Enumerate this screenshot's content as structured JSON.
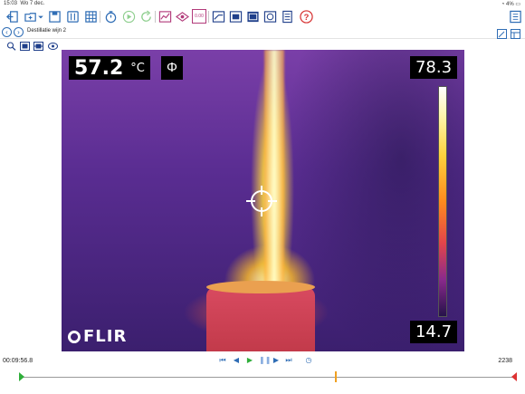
{
  "status": {
    "time": "15:03",
    "date": "Wo 7 dec.",
    "battery": "4%"
  },
  "document": {
    "title": "Destillatie wijn 2"
  },
  "toolbar": {
    "icons": [
      "back-icon",
      "open-folder-icon",
      "save-icon",
      "sensor-settings-icon",
      "table-icon",
      "timer-icon",
      "play-icon",
      "refresh-icon",
      "graph-icon",
      "display-icon",
      "value-icon",
      "gauge-icon",
      "video-icon",
      "camera-icon",
      "web-icon",
      "document-icon",
      "help-icon",
      "notebook-icon"
    ],
    "value_label": "0.00"
  },
  "viewer": {
    "temperature": "57.2",
    "unit": "°C",
    "mode_symbol": "Φ",
    "scale_max": "78.3",
    "scale_min": "14.7",
    "scale_level": 0.56,
    "logo_text": "FLIR"
  },
  "timebar": {
    "elapsed": "00:09:56.8",
    "frames": "2238",
    "position": 0.638
  }
}
